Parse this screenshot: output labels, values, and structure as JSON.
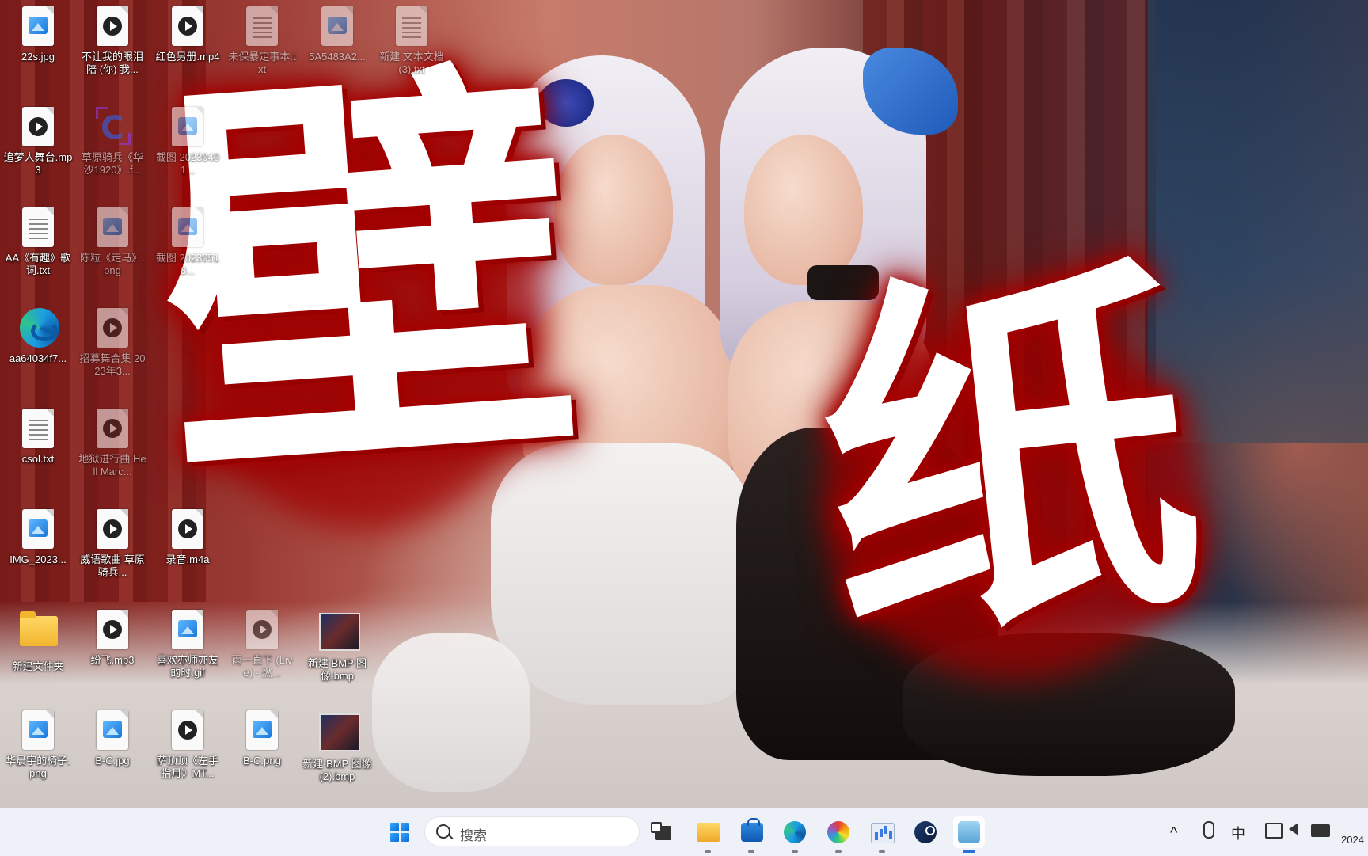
{
  "desktop": {
    "icons": [
      {
        "label": "22s.jpg",
        "type": "image"
      },
      {
        "label": "不让我的眼泪陪 (你) 我...",
        "type": "media"
      },
      {
        "label": "红色另册.mp4",
        "type": "media"
      },
      {
        "label": "未保暴定事本.txt",
        "type": "text"
      },
      {
        "label": "5A5483A2...",
        "type": "image"
      },
      {
        "label": "新建 文本文档 (3).txt",
        "type": "text"
      },
      {
        "label": "追梦人舞台.mp3",
        "type": "media"
      },
      {
        "label": "草原骑兵《华沙1920》.f...",
        "type": "capcut"
      },
      {
        "label": "截图 20230401...",
        "type": "image"
      },
      {
        "label": "AA《有趣》歌词.txt",
        "type": "text"
      },
      {
        "label": "陈粒《走马》.png",
        "type": "image"
      },
      {
        "label": "截图 20230518...",
        "type": "image"
      },
      {
        "label": "aa64034f7...",
        "type": "edge"
      },
      {
        "label": "招募舞合集 2023年3...",
        "type": "media"
      },
      {
        "label": "csol.txt",
        "type": "text"
      },
      {
        "label": "地狱进行曲 Hell Marc...",
        "type": "media"
      },
      {
        "label": "IMG_2023...",
        "type": "image"
      },
      {
        "label": "威语歌曲 草原骑兵...",
        "type": "media"
      },
      {
        "label": "录音.m4a",
        "type": "media"
      },
      {
        "label": "新建文件夹",
        "type": "folder"
      },
      {
        "label": "纷飞.mp3",
        "type": "media"
      },
      {
        "label": "喜欢亦师亦友的时.gif",
        "type": "image"
      },
      {
        "label": "雨一直下 (Live) - 燃...",
        "type": "media"
      },
      {
        "label": "新建 BMP 图像.bmp",
        "type": "bmp"
      },
      {
        "label": "华晨宇的椅子.png",
        "type": "image"
      },
      {
        "label": "B-C.jpg",
        "type": "image"
      },
      {
        "label": "萨顶顶《左手指月》MT...",
        "type": "media"
      },
      {
        "label": "B-C.png",
        "type": "image"
      },
      {
        "label": "新建 BMP 图像 (2).bmp",
        "type": "bmp"
      }
    ]
  },
  "overlay": {
    "char1": "壁",
    "char2": "纸"
  },
  "taskbar": {
    "search_placeholder": "搜索",
    "apps": [
      "task-view",
      "file-explorer",
      "microsoft-store",
      "edge",
      "color-app",
      "graph-app",
      "steam",
      "anime-app"
    ],
    "active_app": "anime-app",
    "tray": {
      "chevron": "^",
      "ime": "中",
      "date_partial": "2024"
    }
  },
  "colors": {
    "overlay_glow": "#a30000",
    "taskbar_bg": "#eef1f7",
    "accent": "#2b6fd6"
  }
}
